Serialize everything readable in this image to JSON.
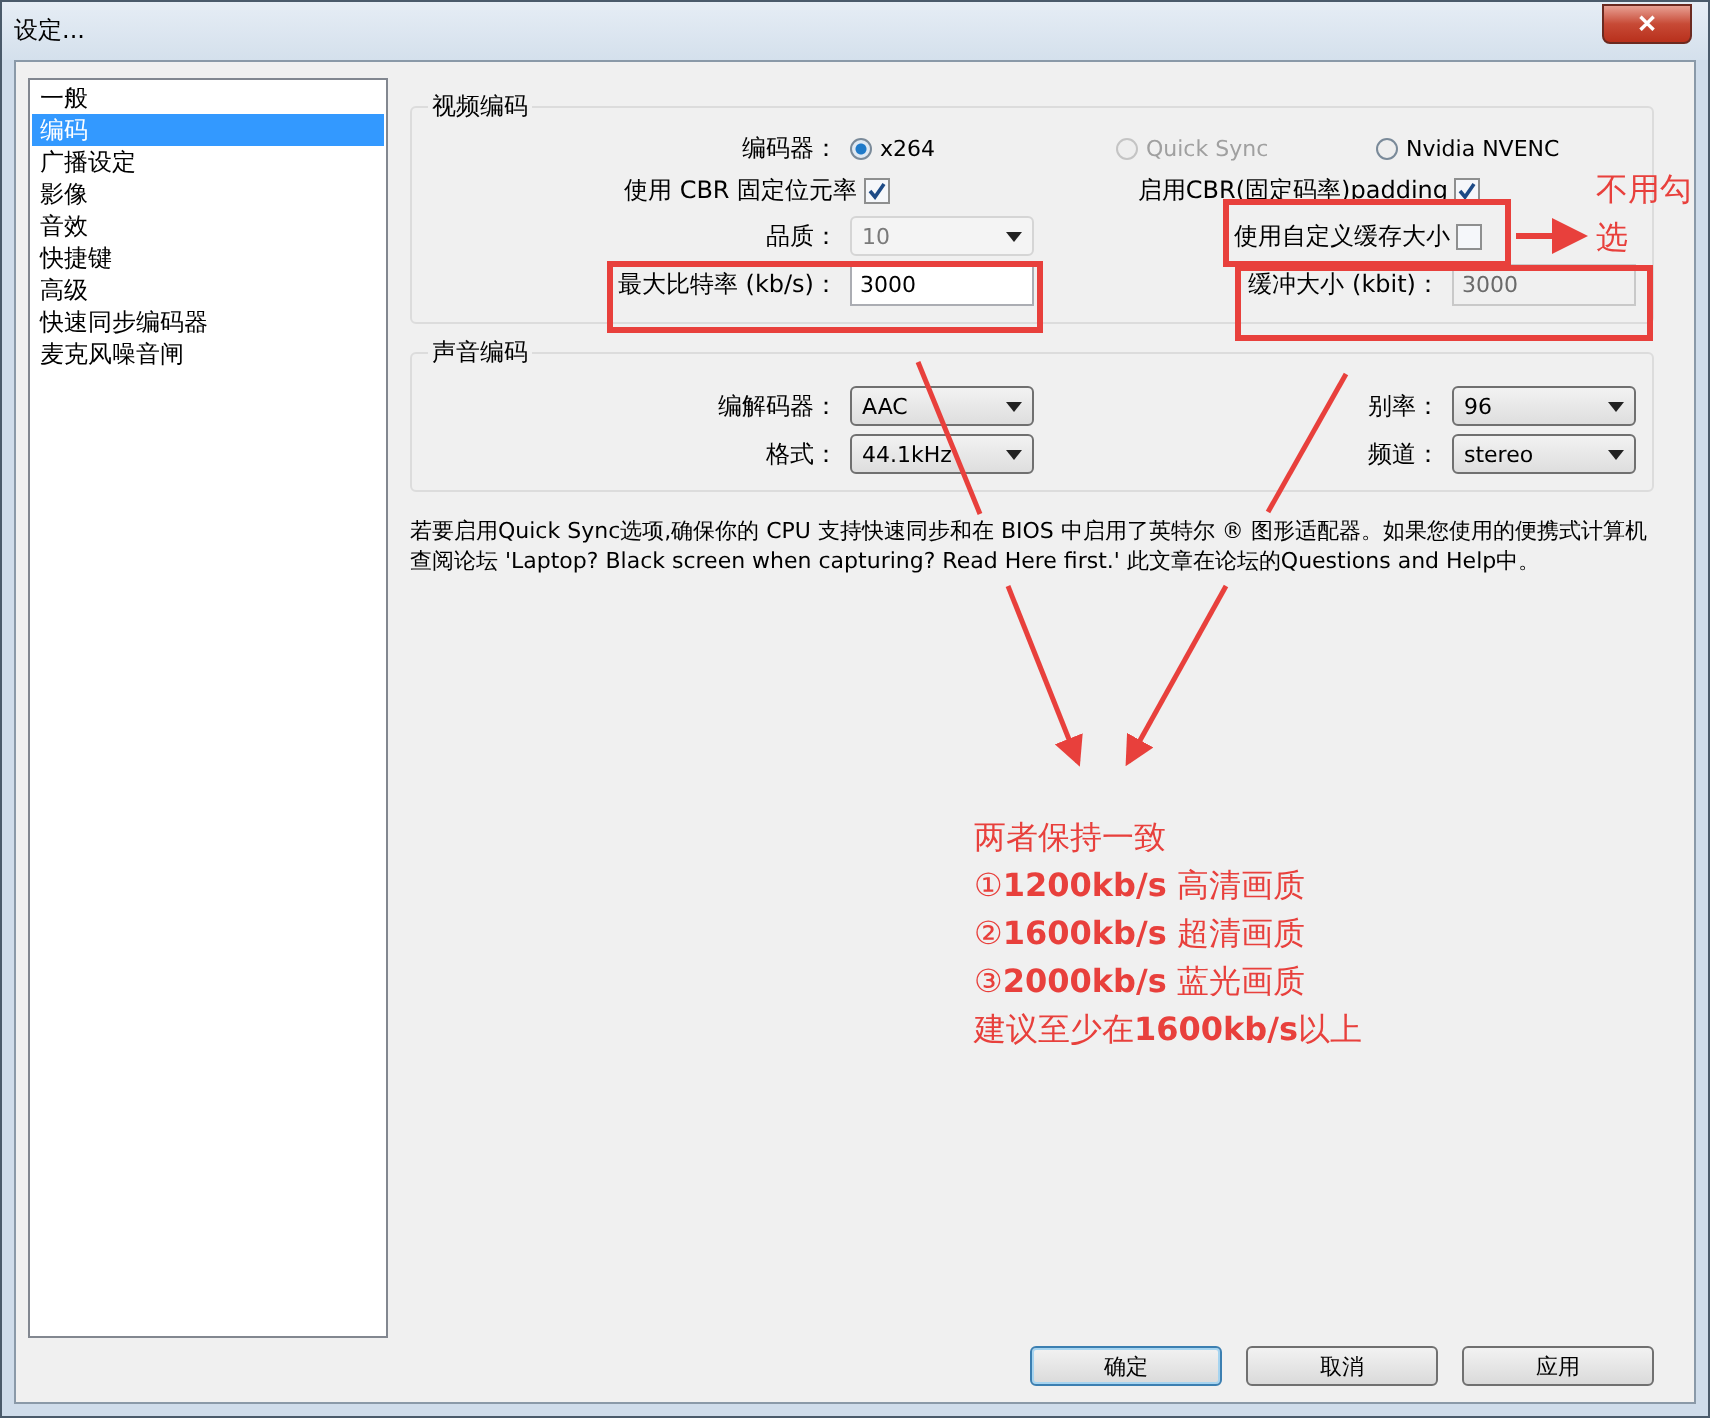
{
  "window": {
    "title": "设定...",
    "close": "✕"
  },
  "sidebar": {
    "items": [
      {
        "label": "一般",
        "selected": false
      },
      {
        "label": "编码",
        "selected": true
      },
      {
        "label": "广播设定",
        "selected": false
      },
      {
        "label": "影像",
        "selected": false
      },
      {
        "label": "音效",
        "selected": false
      },
      {
        "label": "快捷键",
        "selected": false
      },
      {
        "label": "高级",
        "selected": false
      },
      {
        "label": "快速同步编码器",
        "selected": false
      },
      {
        "label": "麦克风噪音闸",
        "selected": false
      }
    ]
  },
  "video": {
    "title": "视频编码",
    "encoder_label": "编码器：",
    "encoders": [
      {
        "label": "x264",
        "selected": true,
        "disabled": false
      },
      {
        "label": "Quick Sync",
        "selected": false,
        "disabled": true
      },
      {
        "label": "Nvidia NVENC",
        "selected": false,
        "disabled": false
      }
    ],
    "cbr": {
      "label": "使用 CBR 固定位元率",
      "checked": true
    },
    "padding": {
      "label": "启用CBR(固定码率)padding",
      "checked": true
    },
    "quality": {
      "label": "品质：",
      "value": "10",
      "disabled": true
    },
    "custom_buffer": {
      "label": "使用自定义缓存大小",
      "checked": false
    },
    "max_bitrate": {
      "label": "最大比特率 (kb/s)：",
      "value": "3000",
      "disabled": false
    },
    "buffer_size": {
      "label": "缓冲大小 (kbit)：",
      "value": "3000",
      "disabled": true
    }
  },
  "audio": {
    "title": "声音编码",
    "fields": [
      {
        "label": "编解码器：",
        "value": "AAC"
      },
      {
        "label": "别率：",
        "value": "96"
      },
      {
        "label": "格式：",
        "value": "44.1kHz"
      },
      {
        "label": "频道：",
        "value": "stereo"
      }
    ]
  },
  "note": "若要启用Quick Sync选项,确保你的 CPU 支持快速同步和在 BIOS 中启用了英特尔 ® 图形适配器。如果您使用的便携式计算机查阅论坛 'Laptop? Black screen when capturing? Read Here first.' 此文章在论坛的Questions and Help中。",
  "buttons": [
    {
      "label": "确定",
      "default": true
    },
    {
      "label": "取消",
      "default": false
    },
    {
      "label": "应用",
      "default": false
    }
  ],
  "annotations": {
    "side_note": [
      "不用勾",
      "选"
    ],
    "lines": [
      "两者保持一致",
      "①**1200kb/s** 高清画质",
      "②**1600kb/s** 超清画质",
      "③**2000kb/s** 蓝光画质",
      "建议至少在**1600kb/s**以上"
    ]
  }
}
